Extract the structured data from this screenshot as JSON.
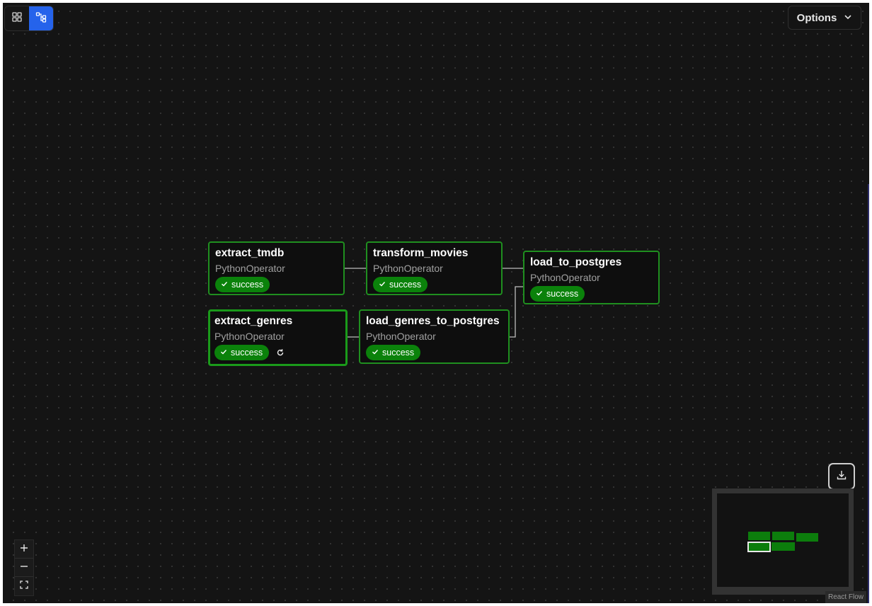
{
  "toolbar": {
    "view_options": [
      {
        "name": "grid-view",
        "active": false
      },
      {
        "name": "graph-view",
        "active": true
      }
    ],
    "options_label": "Options"
  },
  "graph": {
    "nodes": [
      {
        "id": "extract_tmdb",
        "title": "extract_tmdb",
        "operator": "PythonOperator",
        "status": "success",
        "retry": false,
        "selected": false
      },
      {
        "id": "transform_movies",
        "title": "transform_movies",
        "operator": "PythonOperator",
        "status": "success",
        "retry": false,
        "selected": false
      },
      {
        "id": "load_to_postgres",
        "title": "load_to_postgres",
        "operator": "PythonOperator",
        "status": "success",
        "retry": false,
        "selected": false
      },
      {
        "id": "extract_genres",
        "title": "extract_genres",
        "operator": "PythonOperator",
        "status": "success",
        "retry": true,
        "selected": true
      },
      {
        "id": "load_genres_to_postgres",
        "title": "load_genres_to_postgres",
        "operator": "PythonOperator",
        "status": "success",
        "retry": false,
        "selected": false
      }
    ],
    "edges": [
      {
        "from": "extract_tmdb",
        "to": "transform_movies"
      },
      {
        "from": "transform_movies",
        "to": "load_to_postgres"
      },
      {
        "from": "extract_genres",
        "to": "load_genres_to_postgres"
      },
      {
        "from": "load_genres_to_postgres",
        "to": "load_to_postgres"
      }
    ]
  },
  "colors": {
    "canvas_bg": "#141414",
    "node_border_success": "#1f8f1f",
    "status_success": "#0b820b",
    "accent_active": "#2563eb",
    "edge": "#bdbdbd"
  },
  "icons": {
    "grid_view": "grid-view-icon",
    "graph_view": "graph-view-icon",
    "options_chevron": "chevron-down-icon",
    "status": "check-icon",
    "retry": "refresh-icon",
    "download": "download-icon",
    "zoom_in": "plus-icon",
    "zoom_out": "minus-icon",
    "fit_view": "fit-view-icon"
  },
  "attribution": "React Flow"
}
